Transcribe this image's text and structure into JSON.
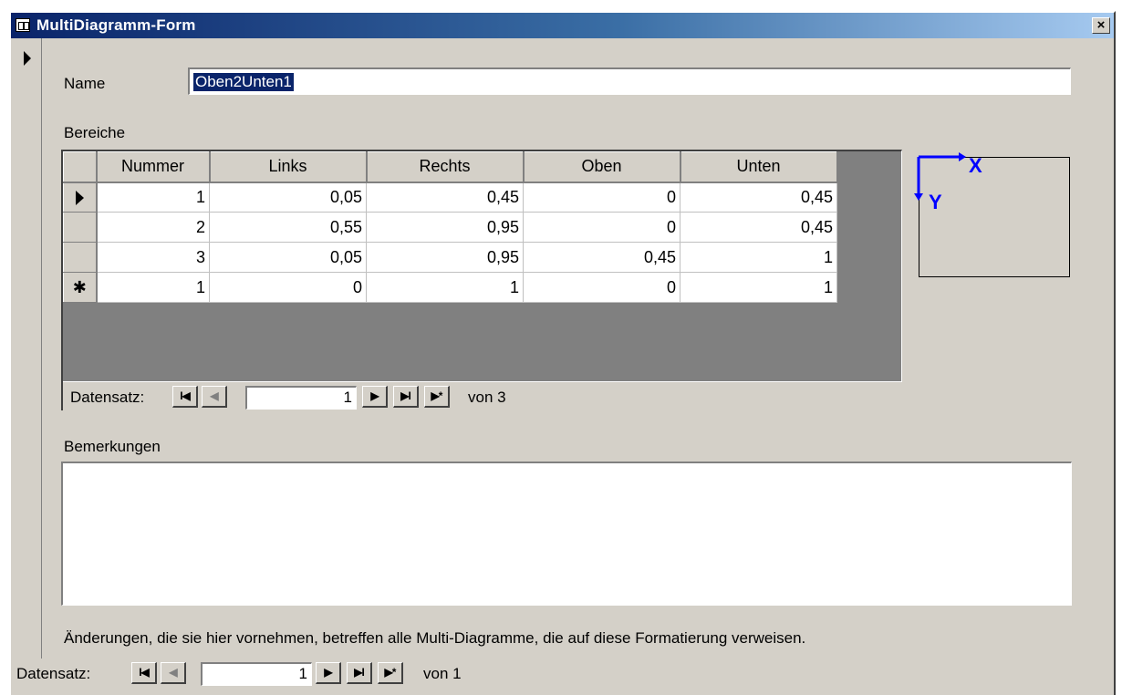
{
  "window": {
    "title": "MultiDiagramm-Form",
    "close_label": "×"
  },
  "form": {
    "name_label": "Name",
    "name_value": "Oben2Unten1",
    "bereiche_label": "Bereiche",
    "bemerkungen_label": "Bemerkungen",
    "bemerkungen_value": "",
    "info_text": "Änderungen, die sie hier vornehmen, betreffen alle Multi-Diagramme, die auf diese Formatierung verweisen."
  },
  "grid": {
    "columns": [
      "Nummer",
      "Links",
      "Rechts",
      "Oben",
      "Unten"
    ],
    "rows": [
      {
        "marker": "current",
        "cells": [
          "1",
          "0,05",
          "0,45",
          "0",
          "0,45"
        ]
      },
      {
        "marker": "",
        "cells": [
          "2",
          "0,55",
          "0,95",
          "0",
          "0,45"
        ]
      },
      {
        "marker": "",
        "cells": [
          "3",
          "0,05",
          "0,95",
          "0,45",
          "1"
        ]
      },
      {
        "marker": "new",
        "cells": [
          "1",
          "0",
          "1",
          "0",
          "1"
        ]
      }
    ]
  },
  "subform_nav": {
    "label": "Datensatz:",
    "record": "1",
    "of_text": "von 3",
    "first": "I◀",
    "prev": "◀",
    "next": "▶",
    "last": "▶I",
    "new": "▶*"
  },
  "main_nav": {
    "label": "Datensatz:",
    "record": "1",
    "of_text": "von 1",
    "first": "I◀",
    "prev": "◀",
    "next": "▶",
    "last": "▶I",
    "new": "▶*"
  },
  "coord_diagram": {
    "x_label": "X",
    "y_label": "Y",
    "axis_color": "#0000ff"
  },
  "icons": {
    "new_row_marker": "✱"
  }
}
